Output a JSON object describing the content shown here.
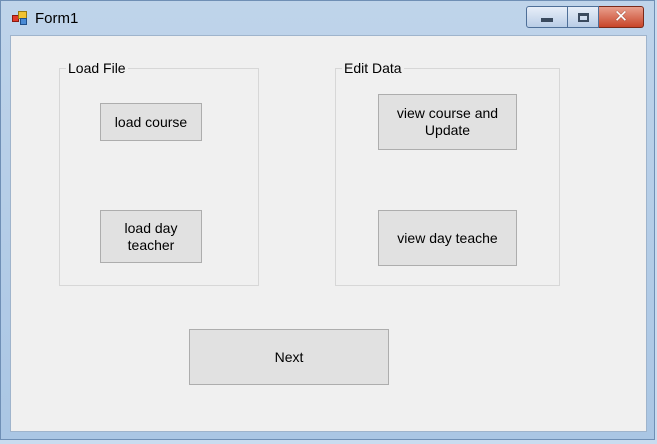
{
  "window": {
    "title": "Form1",
    "icon": "winforms-app-icon"
  },
  "caption_buttons": {
    "minimize": "minimize-icon",
    "maximize": "maximize-icon",
    "close": "close-icon"
  },
  "groups": {
    "load_file": {
      "label": "Load File",
      "buttons": {
        "load_course": "load course",
        "load_day_teacher": "load day teacher"
      }
    },
    "edit_data": {
      "label": "Edit Data",
      "buttons": {
        "view_course_update": "view course and Update",
        "view_day_teache": "view day teache"
      }
    }
  },
  "next_button": "Next"
}
